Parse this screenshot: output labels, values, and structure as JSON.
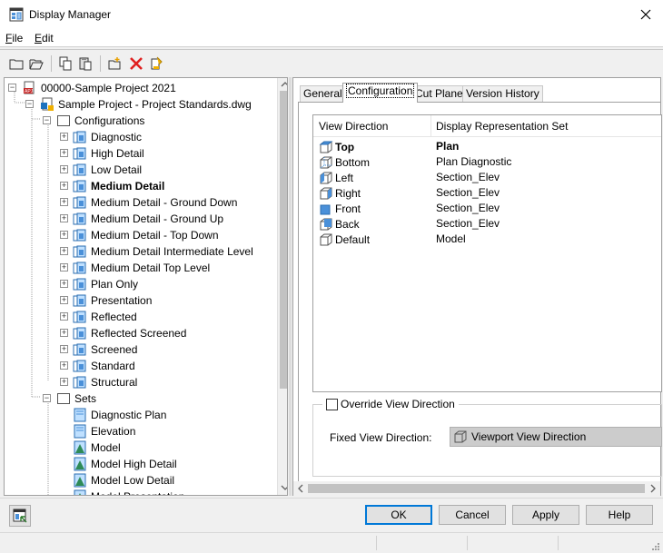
{
  "window": {
    "title": "Display Manager"
  },
  "menu": {
    "file_prefix": "F",
    "file_rest": "ile",
    "edit_prefix": "E",
    "edit_rest": "dit"
  },
  "tree": {
    "root": "00000-Sample Project 2021",
    "drawing": "Sample Project - Project Standards.dwg",
    "configurations_label": "Configurations",
    "configurations": [
      "Diagnostic",
      "High Detail",
      "Low Detail",
      "Medium Detail",
      "Medium Detail - Ground Down",
      "Medium Detail - Ground Up",
      "Medium Detail - Top Down",
      "Medium Detail Intermediate Level",
      "Medium Detail Top Level",
      "Plan Only",
      "Presentation",
      "Reflected",
      "Reflected Screened",
      "Screened",
      "Standard",
      "Structural"
    ],
    "selected": "Medium Detail",
    "sets_label": "Sets",
    "sets": [
      "Diagnostic Plan",
      "Elevation",
      "Model",
      "Model High Detail",
      "Model Low Detail",
      "Model Presentation"
    ]
  },
  "tabs": [
    "General",
    "Configuration",
    "Cut Plane",
    "Version History"
  ],
  "active_tab": "Configuration",
  "listview": {
    "headers": [
      "View Direction",
      "Display Representation Set"
    ],
    "rows": [
      {
        "view": "Top",
        "set": "Plan",
        "bold": true,
        "icon": "cube-top-icon"
      },
      {
        "view": "Bottom",
        "set": "Plan Diagnostic",
        "icon": "cube-bottom-icon"
      },
      {
        "view": "Left",
        "set": "Section_Elev",
        "icon": "cube-left-icon"
      },
      {
        "view": "Right",
        "set": "Section_Elev",
        "icon": "cube-right-icon"
      },
      {
        "view": "Front",
        "set": "Section_Elev",
        "icon": "cube-front-icon"
      },
      {
        "view": "Back",
        "set": "Section_Elev",
        "icon": "cube-back-icon"
      },
      {
        "view": "Default",
        "set": "Model",
        "icon": "cube-default-icon"
      }
    ]
  },
  "override": {
    "checkbox_label": "Override View Direction",
    "checked": false,
    "fixed_label": "Fixed View Direction:",
    "fixed_value": "Viewport View Direction"
  },
  "buttons": {
    "ok": "OK",
    "cancel": "Cancel",
    "apply": "Apply",
    "help": "Help"
  },
  "colors": {
    "accent": "#0078d7",
    "cube_fill": "#4a90d9",
    "red": "#e02020"
  }
}
